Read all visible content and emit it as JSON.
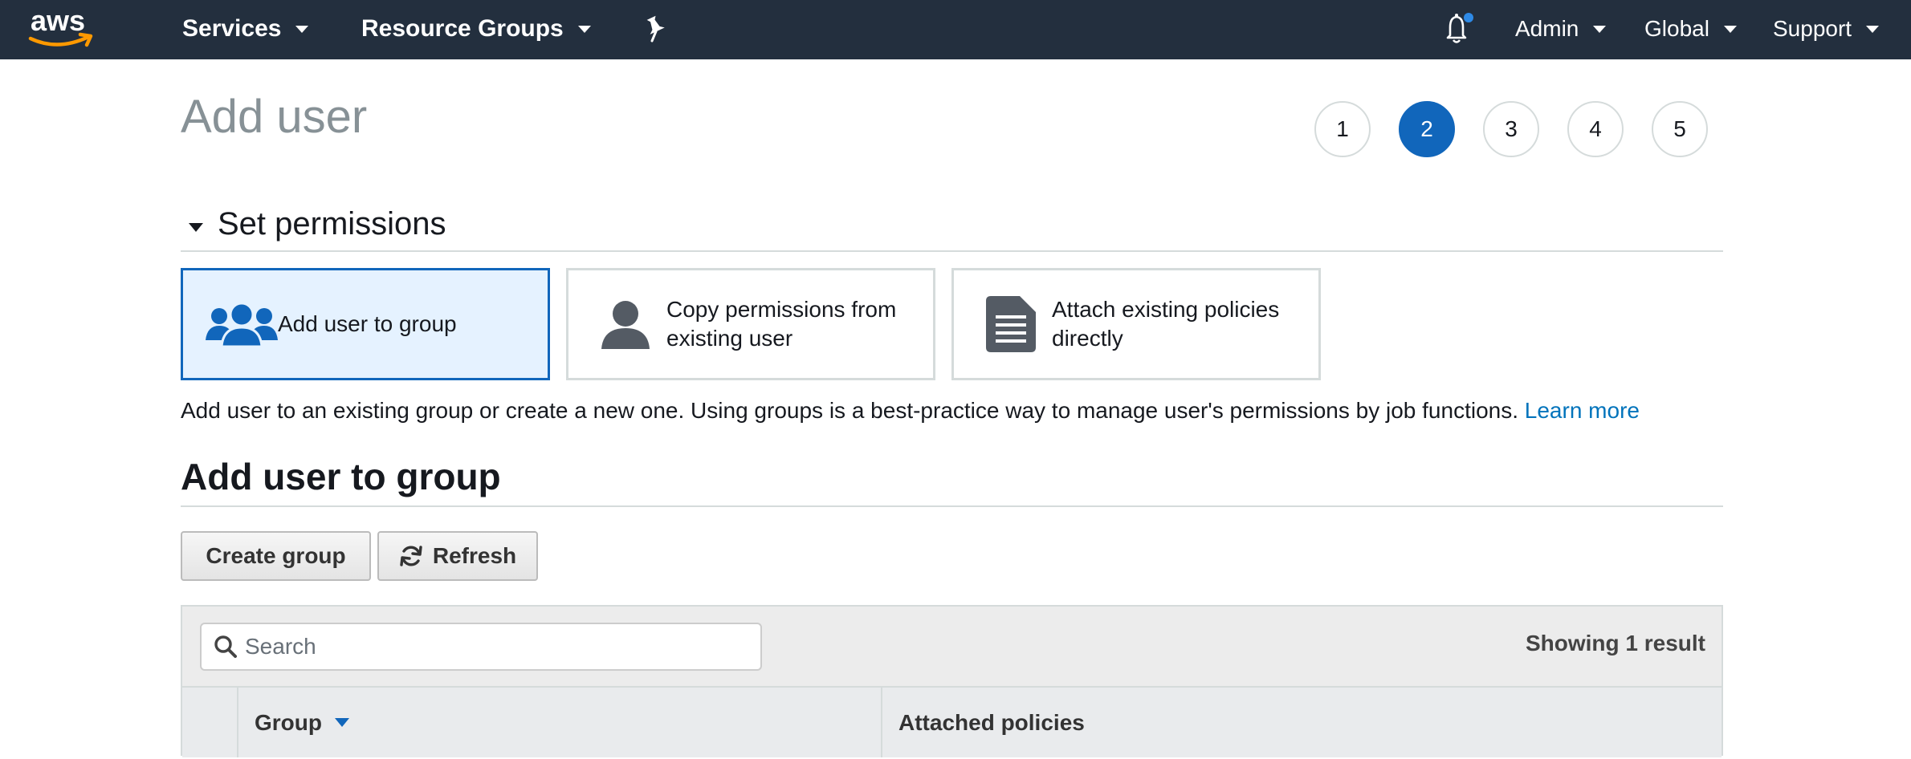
{
  "nav": {
    "logo_text": "aws",
    "services_label": "Services",
    "resource_groups_label": "Resource Groups",
    "admin_label": "Admin",
    "global_label": "Global",
    "support_label": "Support",
    "notification_dot_color": "#2e8ae6"
  },
  "page": {
    "title": "Add user",
    "steps": [
      "1",
      "2",
      "3",
      "4",
      "5"
    ],
    "active_step": "2"
  },
  "permissions": {
    "section_title": "Set permissions",
    "options": [
      {
        "label": "Add user to group",
        "icon": "users-group-icon",
        "selected": true
      },
      {
        "label": "Copy permissions from existing user",
        "icon": "user-icon",
        "selected": false
      },
      {
        "label": "Attach existing policies directly",
        "icon": "document-icon",
        "selected": false
      }
    ],
    "description": "Add user to an existing group or create a new one. Using groups is a best-practice way to manage user's permissions by job functions.",
    "learn_more": "Learn more"
  },
  "group_section": {
    "title": "Add user to group",
    "create_group_label": "Create group",
    "refresh_label": "Refresh",
    "search_placeholder": "Search",
    "result_count": "Showing 1 result",
    "columns": [
      "Group",
      "Attached policies"
    ]
  },
  "colors": {
    "nav_bg": "#232f3e",
    "accent": "#1166bb",
    "selected_bg": "#e5f2ff",
    "link": "#0073bb",
    "aws_orange": "#ff9900"
  }
}
